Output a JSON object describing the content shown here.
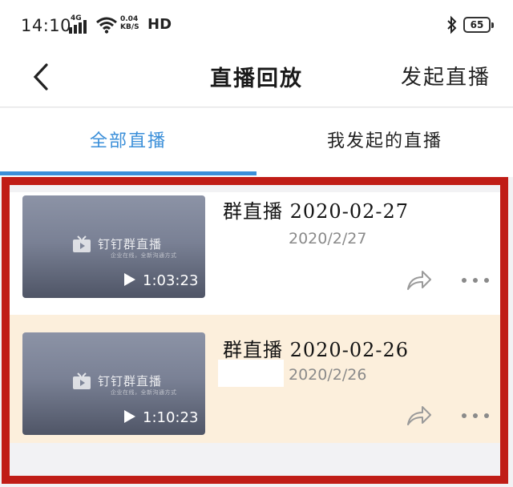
{
  "status_bar": {
    "time": "14:10",
    "network": "4G",
    "speed_value": "0.04",
    "speed_unit": "KB/S",
    "hd": "HD",
    "battery": "65"
  },
  "nav": {
    "back_icon": "chevron-left-icon",
    "title": "直播回放",
    "action_label": "发起直播"
  },
  "tabs": [
    {
      "label": "全部直播",
      "active": true
    },
    {
      "label": "我发起的直播",
      "active": false
    }
  ],
  "items": [
    {
      "name": "群直播 2020-02-27",
      "date": "2020/2/27",
      "duration": "1:03:23",
      "thumb_brand": "钉钉群直播",
      "thumb_slogan": "企业在线，全新沟通方式"
    },
    {
      "name": "群直播 2020-02-26",
      "date": "2020/2/26",
      "duration": "1:10:23",
      "thumb_brand": "钉钉群直播",
      "thumb_slogan": "企业在线，全新沟通方式"
    }
  ],
  "colors": {
    "accent": "#3b8fd9",
    "highlight_border": "#c01d16",
    "selected_row": "#fcefdc",
    "date_text": "#8a8a8a"
  }
}
